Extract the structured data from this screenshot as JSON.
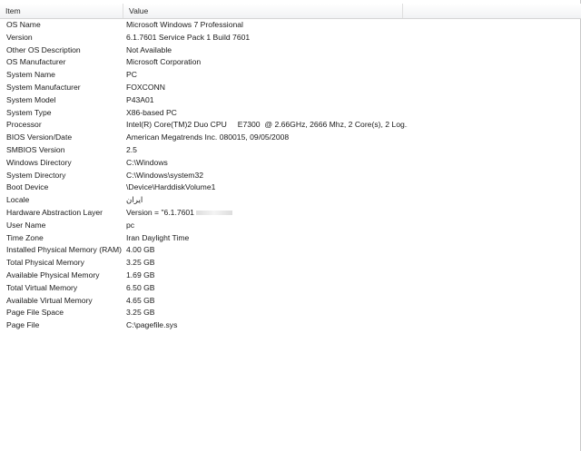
{
  "header": {
    "item_label": "Item",
    "value_label": "Value"
  },
  "rows": [
    {
      "item": "OS Name",
      "value": "Microsoft Windows 7 Professional"
    },
    {
      "item": "Version",
      "value": "6.1.7601 Service Pack 1 Build 7601"
    },
    {
      "item": "Other OS Description",
      "value": "Not Available"
    },
    {
      "item": "OS Manufacturer",
      "value": "Microsoft Corporation"
    },
    {
      "item": "System Name",
      "value": "PC"
    },
    {
      "item": "System Manufacturer",
      "value": "FOXCONN"
    },
    {
      "item": "System Model",
      "value": "P43A01"
    },
    {
      "item": "System Type",
      "value": "X86-based PC"
    },
    {
      "item": "Processor",
      "value": "Intel(R) Core(TM)2 Duo CPU     E7300  @ 2.66GHz, 2666 Mhz, 2 Core(s), 2 Log..."
    },
    {
      "item": "BIOS Version/Date",
      "value": "American Megatrends Inc. 080015, 09/05/2008"
    },
    {
      "item": "SMBIOS Version",
      "value": "2.5"
    },
    {
      "item": "Windows Directory",
      "value": "C:\\Windows"
    },
    {
      "item": "System Directory",
      "value": "C:\\Windows\\system32"
    },
    {
      "item": "Boot Device",
      "value": "\\Device\\HarddiskVolume1"
    },
    {
      "item": "Locale",
      "value": "ایران"
    },
    {
      "item": "Hardware Abstraction Layer",
      "value": "Version = \"6.1.7601"
    },
    {
      "item": "User Name",
      "value": "pc"
    },
    {
      "item": "Time Zone",
      "value": "Iran Daylight Time"
    },
    {
      "item": "Installed Physical Memory (RAM)",
      "value": "4.00 GB"
    },
    {
      "item": "Total Physical Memory",
      "value": "3.25 GB"
    },
    {
      "item": "Available Physical Memory",
      "value": "1.69 GB"
    },
    {
      "item": "Total Virtual Memory",
      "value": "6.50 GB"
    },
    {
      "item": "Available Virtual Memory",
      "value": "4.65 GB"
    },
    {
      "item": "Page File Space",
      "value": "3.25 GB"
    },
    {
      "item": "Page File",
      "value": "C:\\pagefile.sys"
    }
  ]
}
